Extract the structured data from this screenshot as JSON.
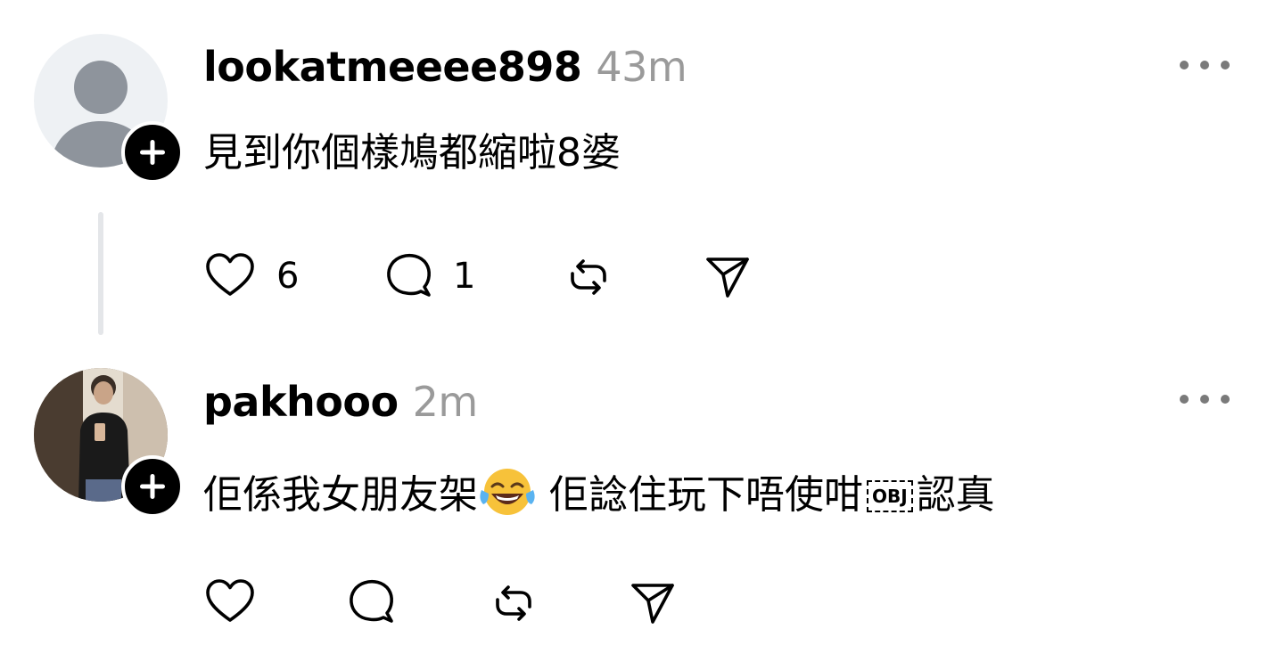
{
  "posts": [
    {
      "username": "lookatmeeee898",
      "time": "43m",
      "text": "見到你個樣鳩都縮啦8婆",
      "likes": "6",
      "replies": "1",
      "avatar": "default-person-icon"
    },
    {
      "username": "pakhooo",
      "time": "2m",
      "text_before": "佢係我女朋友架",
      "emoji": "face-with-tears-of-joy-icon",
      "text_after": " 佢諗住玩下唔使咁",
      "obj_placeholder": "OBJ",
      "text_end": "認真",
      "avatar": "user-photo"
    }
  ],
  "icons": {
    "follow": "plus-icon",
    "more": "more-options-icon",
    "like": "heart-icon",
    "reply": "comment-icon",
    "repost": "repost-icon",
    "share": "send-icon"
  },
  "colors": {
    "timestamp": "#9a9a9a",
    "thread_line": "#e4e6e9",
    "avatar_bg": "#eef1f4",
    "text": "#000000"
  }
}
